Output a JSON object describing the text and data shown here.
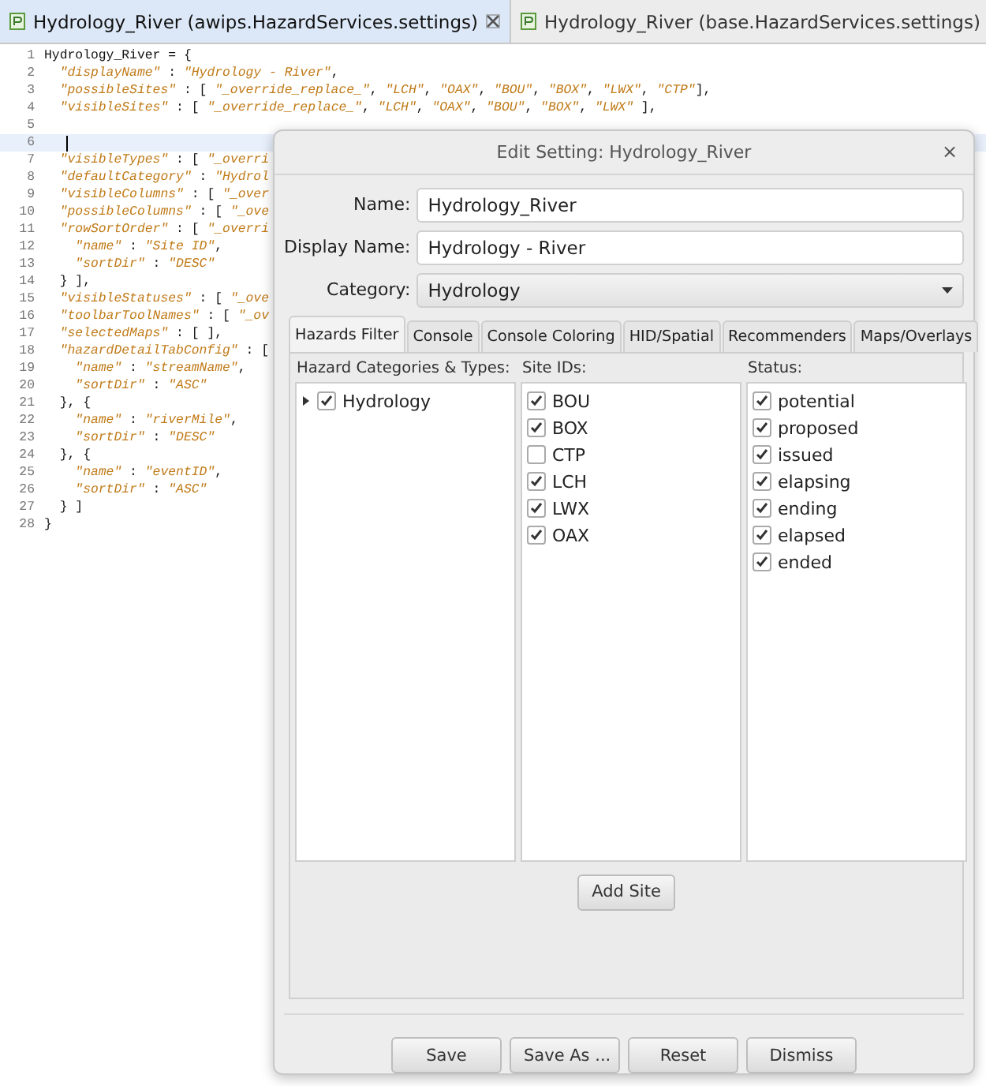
{
  "editor_tabs": [
    {
      "label": "Hydrology_River (awips.HazardServices.settings)",
      "selected": true,
      "closable": true
    },
    {
      "label": "Hydrology_River (base.HazardServices.settings)",
      "selected": false,
      "closable": false
    }
  ],
  "code_lines": [
    {
      "number": "1",
      "text": "Hydrology_River = {",
      "current": false
    },
    {
      "number": "2",
      "text": "  \"displayName\" : \"Hydrology - River\",",
      "current": false
    },
    {
      "number": "3",
      "text": "  \"possibleSites\" : [ \"_override_replace_\", \"LCH\", \"OAX\", \"BOU\", \"BOX\", \"LWX\", \"CTP\"],",
      "current": false
    },
    {
      "number": "4",
      "text": "  \"visibleSites\" : [ \"_override_replace_\", \"LCH\", \"OAX\", \"BOU\", \"BOX\", \"LWX\" ],",
      "current": false
    },
    {
      "number": "5",
      "current": false
    },
    {
      "number": "6",
      "current": true
    },
    {
      "number": "7",
      "text": "  \"visibleTypes\" : [ \"_overri",
      "current": false
    },
    {
      "number": "8",
      "text": "  \"defaultCategory\" : \"Hydrol",
      "current": false
    },
    {
      "number": "9",
      "text": "  \"visibleColumns\" : [ \"_over",
      "current": false
    },
    {
      "number": "10",
      "text": "  \"possibleColumns\" : [ \"_ove",
      "current": false
    },
    {
      "number": "11",
      "text": "  \"rowSortOrder\" : [ \"_overri",
      "current": false
    },
    {
      "number": "12",
      "text": "    \"name\" : \"Site ID\",",
      "current": false
    },
    {
      "number": "13",
      "text": "    \"sortDir\" : \"DESC\"",
      "current": false
    },
    {
      "number": "14",
      "text": "  } ],",
      "current": false
    },
    {
      "number": "15",
      "text": "  \"visibleStatuses\" : [ \"_ove",
      "current": false
    },
    {
      "number": "16",
      "text": "  \"toolbarToolNames\" : [ \"_ov",
      "current": false
    },
    {
      "number": "17",
      "text": "  \"selectedMaps\" : [ ],",
      "current": false
    },
    {
      "number": "18",
      "text": "  \"hazardDetailTabConfig\" : [",
      "current": false
    },
    {
      "number": "19",
      "text": "    \"name\" : \"streamName\",",
      "current": false
    },
    {
      "number": "20",
      "text": "    \"sortDir\" : \"ASC\"",
      "current": false
    },
    {
      "number": "21",
      "text": "  }, {",
      "current": false
    },
    {
      "number": "22",
      "text": "    \"name\" : \"riverMile\",",
      "current": false
    },
    {
      "number": "23",
      "text": "    \"sortDir\" : \"DESC\"",
      "current": false
    },
    {
      "number": "24",
      "text": "  }, {",
      "current": false
    },
    {
      "number": "25",
      "text": "    \"name\" : \"eventID\",",
      "current": false
    },
    {
      "number": "26",
      "text": "    \"sortDir\" : \"ASC\"",
      "current": false
    },
    {
      "number": "27",
      "text": "  } ]",
      "current": false
    },
    {
      "number": "28",
      "text": "}",
      "current": false
    }
  ],
  "dialog": {
    "title": "Edit Setting: Hydrology_River",
    "close": "×",
    "fields": [
      {
        "label": "Name:",
        "value": "Hydrology_River",
        "kind": "text"
      },
      {
        "label": "Display Name:",
        "value": "Hydrology - River",
        "kind": "text"
      },
      {
        "label": "Category:",
        "value": "Hydrology",
        "kind": "dropdown"
      }
    ],
    "tabs": [
      {
        "label": "Hazards Filter",
        "selected": true
      },
      {
        "label": "Console",
        "selected": false
      },
      {
        "label": "Console Coloring",
        "selected": false
      },
      {
        "label": "HID/Spatial",
        "selected": false
      },
      {
        "label": "Recommenders",
        "selected": false
      },
      {
        "label": "Maps/Overlays",
        "selected": false
      }
    ],
    "hazard_categories": {
      "heading": "Hazard Categories & Types:",
      "items": [
        {
          "label": "Hydrology",
          "checked": true,
          "expanded": false
        }
      ]
    },
    "site_ids": {
      "heading": "Site IDs:",
      "items": [
        {
          "label": "BOU",
          "checked": true
        },
        {
          "label": "BOX",
          "checked": true
        },
        {
          "label": "CTP",
          "checked": false
        },
        {
          "label": "LCH",
          "checked": true
        },
        {
          "label": "LWX",
          "checked": true
        },
        {
          "label": "OAX",
          "checked": true
        }
      ]
    },
    "status": {
      "heading": "Status:",
      "items": [
        {
          "label": "potential",
          "checked": true
        },
        {
          "label": "proposed",
          "checked": true
        },
        {
          "label": "issued",
          "checked": true
        },
        {
          "label": "elapsing",
          "checked": true
        },
        {
          "label": "ending",
          "checked": true
        },
        {
          "label": "elapsed",
          "checked": true
        },
        {
          "label": "ended",
          "checked": true
        }
      ]
    },
    "add_site": "Add Site",
    "buttons": [
      "Save",
      "Save As ...",
      "Reset",
      "Dismiss"
    ]
  }
}
